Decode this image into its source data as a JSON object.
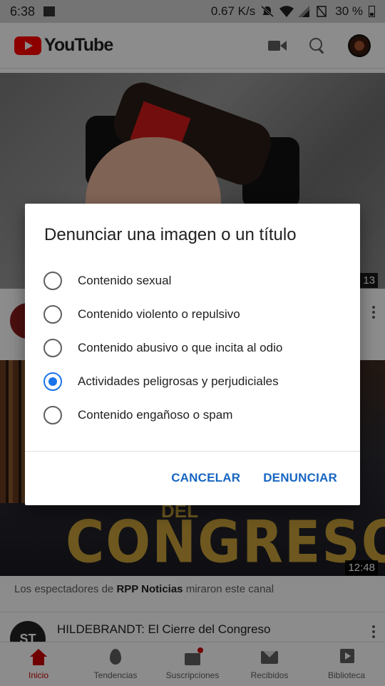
{
  "status_bar": {
    "time": "6:38",
    "speed": "0.67 K/s",
    "battery": "30 %"
  },
  "app_bar": {
    "logo_text": "YouTube"
  },
  "feed": {
    "video1": {
      "duration": "13"
    },
    "video2": {
      "duration": "12:48",
      "overlay_del": "DEL",
      "overlay_title": "CONGRESO"
    },
    "recommendation": {
      "prefix": "Los espectadores de",
      "channel": "RPP Noticias",
      "suffix": "miraron este canal"
    },
    "video3": {
      "title": "HILDEBRANDT: El Cierre del Congreso",
      "channel_initials": "ST"
    }
  },
  "dialog": {
    "title": "Denunciar una imagen o un título",
    "options": [
      {
        "label": "Contenido sexual",
        "selected": false
      },
      {
        "label": "Contenido violento o repulsivo",
        "selected": false
      },
      {
        "label": "Contenido abusivo o que incita al odio",
        "selected": false
      },
      {
        "label": "Actividades peligrosas y perjudiciales",
        "selected": true
      },
      {
        "label": "Contenido engañoso o spam",
        "selected": false
      }
    ],
    "cancel_label": "CANCELAR",
    "report_label": "DENUNCIAR"
  },
  "bottom_nav": {
    "items": [
      {
        "label": "Inicio",
        "icon": "home-icon",
        "active": true
      },
      {
        "label": "Tendencias",
        "icon": "fire-icon",
        "active": false
      },
      {
        "label": "Suscripciones",
        "icon": "subscriptions-icon",
        "active": false
      },
      {
        "label": "Recibidos",
        "icon": "mail-icon",
        "active": false
      },
      {
        "label": "Biblioteca",
        "icon": "library-icon",
        "active": false
      }
    ]
  },
  "colors": {
    "accent": "#1a73e8",
    "brand": "#ff0000",
    "active_nav": "#cc0000"
  }
}
